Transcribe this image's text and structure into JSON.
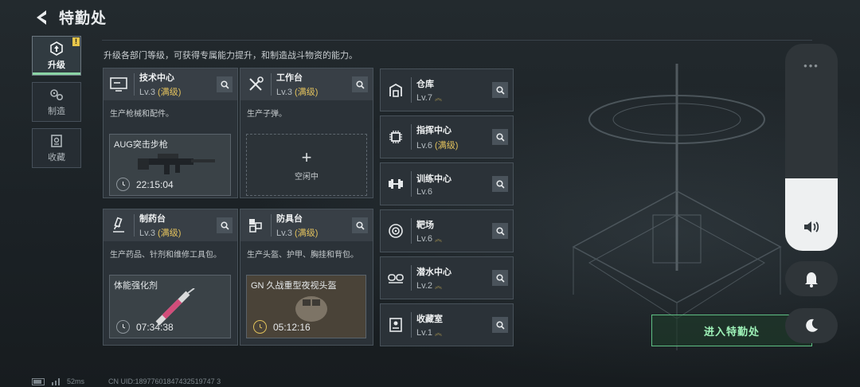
{
  "header": {
    "title": "特勤处"
  },
  "sidebar": {
    "items": [
      {
        "label": "升级",
        "icon": "upgrade-icon",
        "active": true,
        "badge": "!"
      },
      {
        "label": "制造",
        "icon": "gear-cluster-icon",
        "active": false
      },
      {
        "label": "收藏",
        "icon": "collection-icon",
        "active": false
      }
    ]
  },
  "description": "升级各部门等级，可获得专属能力提升，和制造战斗物资的能力。",
  "depts": {
    "tech": {
      "name": "技术中心",
      "level": "Lv.3",
      "max": "(满级)",
      "desc": "生产枪械和配件。",
      "slot": {
        "item": "AUG突击步枪",
        "timer": "22:15:04"
      }
    },
    "workbench": {
      "name": "工作台",
      "level": "Lv.3",
      "max": "(满级)",
      "desc": "生产子弹。",
      "idle": {
        "plus": "+",
        "label": "空闲中"
      }
    },
    "pharmacy": {
      "name": "制药台",
      "level": "Lv.3",
      "max": "(满级)",
      "desc": "生产药品、针剂和维修工具包。",
      "slot": {
        "item": "体能强化剂",
        "timer": "07:34:38"
      }
    },
    "armor": {
      "name": "防具台",
      "level": "Lv.3",
      "max": "(满级)",
      "desc": "生产头盔、护甲、胸挂和背包。",
      "slot": {
        "item": "GN 久战重型夜视头盔",
        "timer": "05:12:16"
      }
    }
  },
  "rooms": [
    {
      "name": "仓库",
      "level": "Lv.7",
      "max": "",
      "upgradable": true
    },
    {
      "name": "指挥中心",
      "level": "Lv.6",
      "max": "(满级)",
      "upgradable": false
    },
    {
      "name": "训练中心",
      "level": "Lv.6",
      "max": "",
      "upgradable": false
    },
    {
      "name": "靶场",
      "level": "Lv.6",
      "max": "",
      "upgradable": true
    },
    {
      "name": "潜水中心",
      "level": "Lv.2",
      "max": "",
      "upgradable": true
    },
    {
      "name": "收藏室",
      "level": "Lv.1",
      "max": "",
      "upgradable": true
    }
  ],
  "enter_button": "进入特勤处",
  "volume": {
    "dots": "•••",
    "level_percent": 35
  },
  "footer": {
    "ping": "52ms",
    "uid": "CN UID:18977601847432519747 3"
  },
  "colors": {
    "accent": "#8bd5a5",
    "max_level": "#e3c25d",
    "enter": "#9ef2b8"
  }
}
